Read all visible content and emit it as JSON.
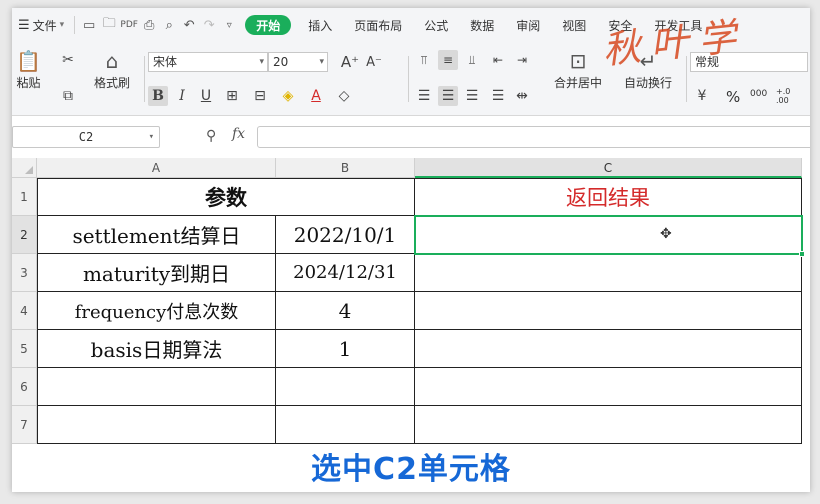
{
  "menubar": {
    "file_label": "文件",
    "tabs": [
      "开始",
      "插入",
      "页面布局",
      "公式",
      "数据",
      "审阅",
      "视图",
      "安全",
      "开发工具"
    ],
    "active_tab": "开始"
  },
  "ribbon": {
    "paste_label": "粘贴",
    "format_painter_label": "格式刷",
    "font_name": "宋体",
    "font_size": "20",
    "merge_center_label": "合并居中",
    "wrap_text_label": "自动换行",
    "number_format": "常规",
    "percent": "%",
    "thousands": "000",
    "decimal_inc": "+.0 .00"
  },
  "formula_bar": {
    "name_box": "C2",
    "fx_label": "fx",
    "formula_value": ""
  },
  "grid": {
    "columns": [
      "A",
      "B",
      "C"
    ],
    "rows": [
      "1",
      "2",
      "3",
      "4",
      "5",
      "6",
      "7"
    ],
    "cells": {
      "A1": "参数",
      "C1": "返回结果",
      "A2": "settlement结算日",
      "B2": "2022/10/1",
      "A3": "maturity到期日",
      "B3": "2024/12/31",
      "A4": "frequency付息次数",
      "B4": "4",
      "A5": "basis日期算法",
      "B5": "1"
    },
    "selected_cell": "C2"
  },
  "caption": "选中C2单元格",
  "watermark": "秋叶学",
  "colors": {
    "accent_green": "#1aae5b",
    "result_red": "#d42a2a",
    "caption_blue": "#1668d6"
  },
  "icons": [
    "menu-icon",
    "chevron-down-icon",
    "new-file-icon",
    "open-icon",
    "pdf-icon",
    "print-icon",
    "print-preview-icon",
    "undo-icon",
    "redo-icon",
    "more-icon",
    "paste-icon",
    "cut-icon",
    "copy-icon",
    "format-painter-icon",
    "bold-icon",
    "italic-icon",
    "underline-icon",
    "border-icon",
    "fill-color-icon",
    "font-color-icon",
    "clear-icon",
    "align-icon",
    "merge-icon",
    "wrap-icon",
    "currency-icon",
    "zoom-icon",
    "fx-icon",
    "cell-cursor-icon"
  ]
}
